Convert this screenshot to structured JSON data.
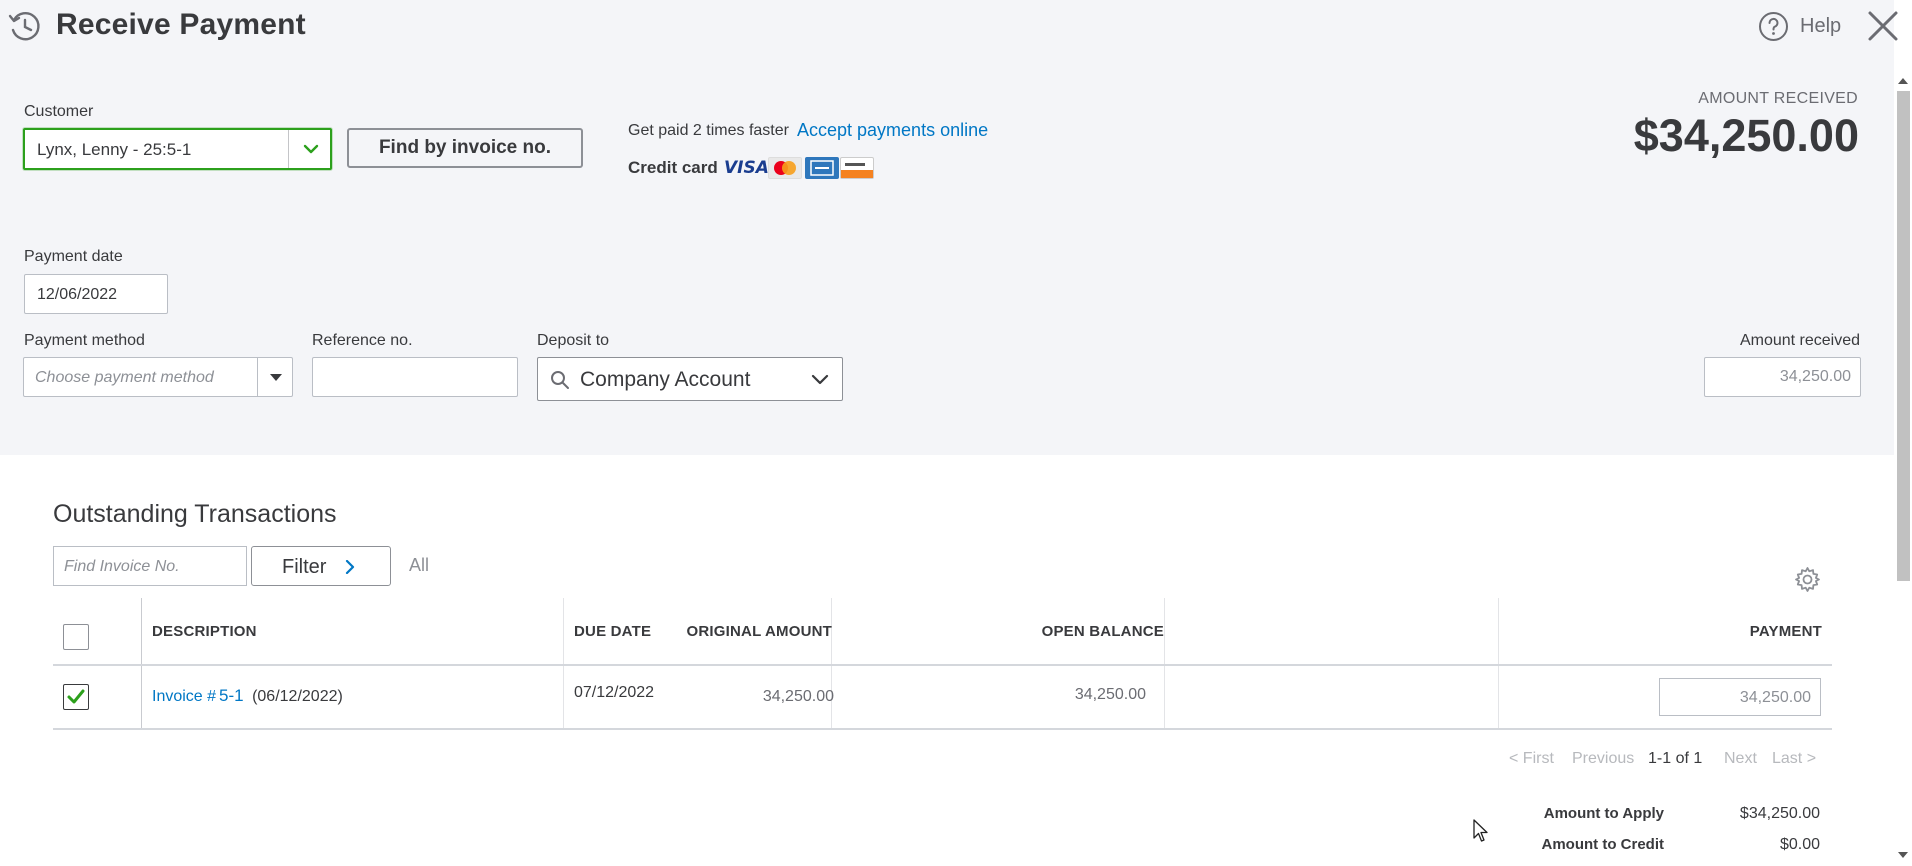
{
  "header": {
    "title": "Receive Payment",
    "help_label": "Help",
    "icons": {
      "history": "history-clock-icon",
      "help": "question-circle-icon",
      "close": "close-icon"
    }
  },
  "customer": {
    "label": "Customer",
    "value": "Lynx, Lenny - 25:5-1",
    "find_button": "Find by invoice no."
  },
  "promo": {
    "get_paid_text": "Get paid 2 times faster",
    "accept_link": "Accept payments online",
    "credit_card_label": "Credit card",
    "card_icons": [
      "visa-icon",
      "mastercard-icon",
      "amex-icon",
      "discover-icon"
    ],
    "visa_text": "VISA"
  },
  "amount_received_header": {
    "label": "AMOUNT RECEIVED",
    "value": "$34,250.00"
  },
  "payment_date": {
    "label": "Payment date",
    "value": "12/06/2022"
  },
  "payment_method": {
    "label": "Payment method",
    "placeholder": "Choose payment method"
  },
  "reference": {
    "label": "Reference no.",
    "value": ""
  },
  "deposit_to": {
    "label": "Deposit to",
    "value": "Company Account"
  },
  "amount_received_field": {
    "label": "Amount received",
    "value": "34,250.00"
  },
  "outstanding": {
    "title": "Outstanding Transactions",
    "find_placeholder": "Find Invoice No.",
    "filter_label": "Filter",
    "all_label": "All",
    "columns": [
      "DESCRIPTION",
      "DUE DATE",
      "ORIGINAL AMOUNT",
      "OPEN BALANCE",
      "PAYMENT"
    ],
    "rows": [
      {
        "checked": true,
        "invoice_prefix": "Invoice #",
        "invoice_number": "5-1",
        "invoice_date": "(06/12/2022)",
        "due_date": "07/12/2022",
        "original_amount": "34,250.00",
        "open_balance": "34,250.00",
        "payment": "34,250.00"
      }
    ],
    "pager": {
      "first": "< First",
      "previous": "Previous",
      "range": "1-1 of 1",
      "next": "Next",
      "last": "Last >"
    }
  },
  "summary": {
    "apply_label": "Amount to Apply",
    "apply_value": "$34,250.00",
    "credit_label": "Amount to Credit",
    "credit_value": "$0.00"
  },
  "colors": {
    "accent_green": "#2ca01c",
    "link_blue": "#0077c5",
    "header_bg": "#f4f5f8",
    "text": "#393a3d"
  }
}
